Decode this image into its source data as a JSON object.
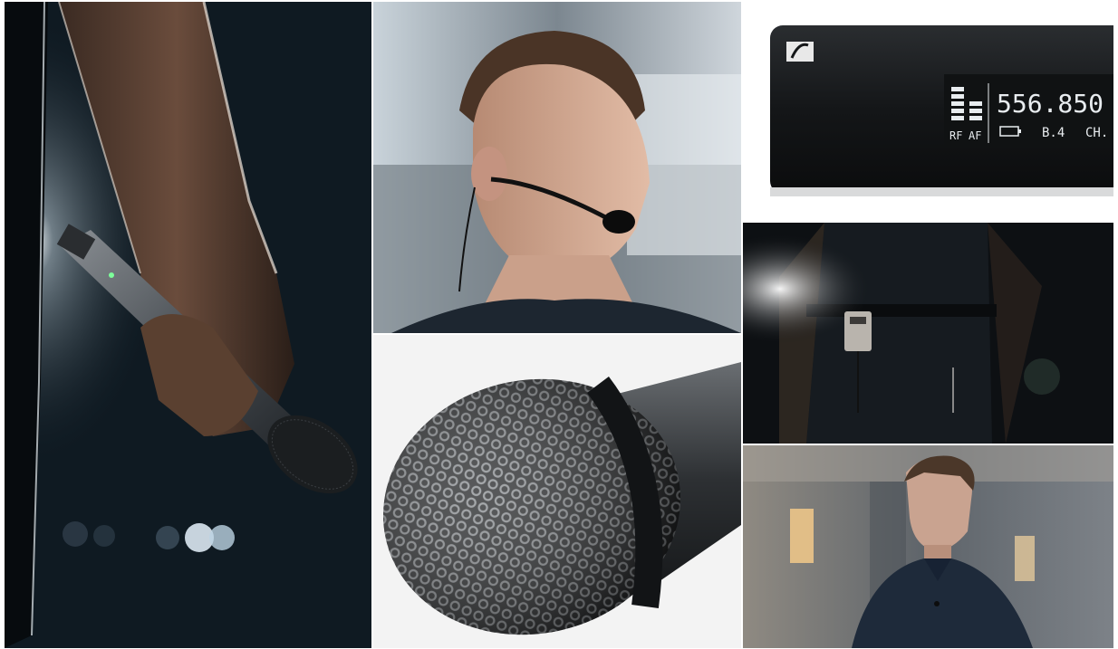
{
  "receiver_display": {
    "frequency": "556.850",
    "bank": "B.4",
    "channel_prefix": "CH.",
    "rf_label": "RF",
    "af_label": "AF"
  },
  "colors": {
    "stage_dark": "#0f1a22",
    "rim_light": "#e6eef2",
    "receiver_body": "#141618",
    "lcd_text": "#e8ecef",
    "grille_metal": "#2a2c2e"
  },
  "icons": [
    "sennheiser-logo-icon",
    "battery-icon",
    "signal-level-bars-icon"
  ]
}
